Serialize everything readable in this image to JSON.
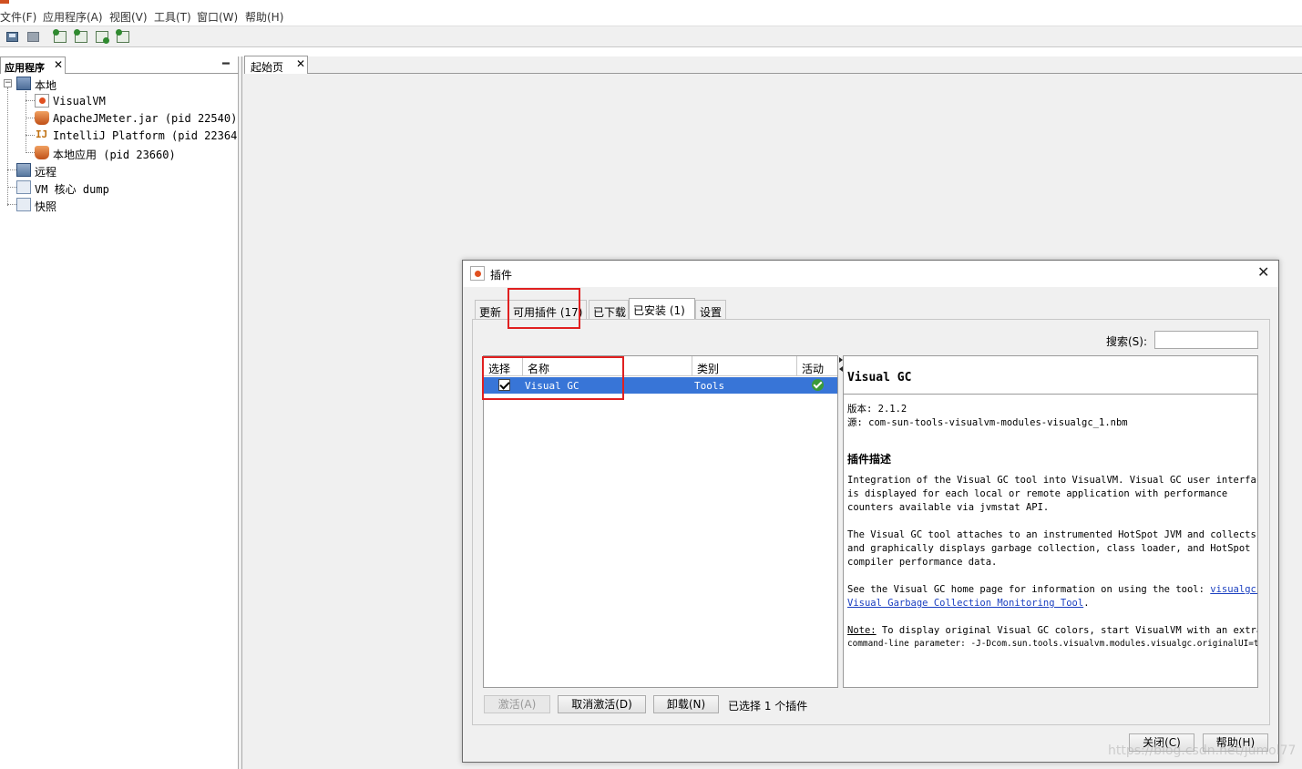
{
  "menu": [
    "文件(F)",
    "应用程序(A)",
    "视图(V)",
    "工具(T)",
    "窗口(W)",
    "帮助(H)"
  ],
  "left_panel": {
    "tab_label": "应用程序",
    "tree": {
      "local": "本地",
      "apps": [
        {
          "label": "VisualVM",
          "icon": "visualvm-icon"
        },
        {
          "label": "ApacheJMeter.jar (pid 22540)",
          "icon": "java-icon"
        },
        {
          "label": "IntelliJ Platform (pid 22364)",
          "icon": "intellij-icon"
        },
        {
          "label": "本地应用 (pid 23660)",
          "icon": "java-icon"
        }
      ],
      "remote": "远程",
      "vm_core_dump": "VM 核心 dump",
      "snapshots": "快照"
    }
  },
  "main_tab": {
    "label": "起始页"
  },
  "dialog": {
    "title": "插件",
    "tabs": [
      "更新",
      "可用插件 (17)",
      "已下载",
      "已安装 (1)",
      "设置"
    ],
    "selected_tab": "已安装 (1)",
    "search_label": "搜索(S):",
    "search_value": "",
    "table": {
      "headers": [
        "选择",
        "名称",
        "类别",
        "活动"
      ],
      "rows": [
        {
          "selected": true,
          "name": "Visual GC",
          "category": "Tools",
          "active": true
        }
      ]
    },
    "detail": {
      "title": "Visual GC",
      "version_line": "版本: 2.1.2",
      "source_line": "源: com-sun-tools-visualvm-modules-visualgc_1.nbm",
      "desc_heading": "插件描述",
      "p1": [
        "Integration of the Visual GC tool into VisualVM. Visual GC user interface",
        "is displayed for each local or remote application with performance",
        "counters available via jvmstat API."
      ],
      "p2": [
        "The Visual GC tool attaches to an instrumented HotSpot JVM and collects",
        "and graphically displays garbage collection, class loader, and HotSpot",
        "compiler performance data."
      ],
      "p3_prefix": "See the Visual GC home page for information on using the tool: ",
      "p3_link_a": "visualgc -",
      "p3_link_b": "Visual Garbage Collection Monitoring Tool",
      "p3_suffix": ".",
      "note_label": "Note:",
      "note_text": " To display original Visual GC colors, start VisualVM with an extra",
      "note_line2": "command-line parameter: -J-Dcom.sun.tools.visualvm.modules.visualgc.originalUI=true"
    },
    "buttons": {
      "activate": "激活(A)",
      "deactivate": "取消激活(D)",
      "uninstall": "卸载(N)",
      "close": "关闭(C)",
      "help": "帮助(H)"
    },
    "selected_count": "已选择 1 个插件"
  },
  "watermark": "https://blog.csdn.net/jumol77",
  "colors": {
    "selection": "#3875d7",
    "highlight_box": "#e02020",
    "link": "#1a3fc0"
  }
}
